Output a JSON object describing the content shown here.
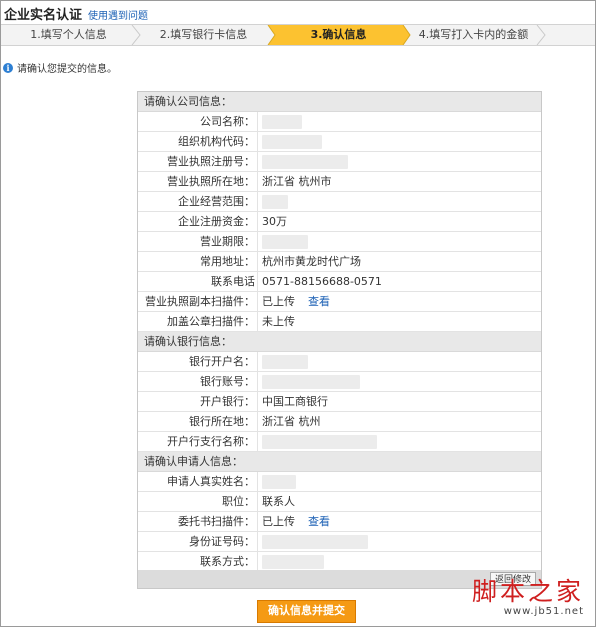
{
  "header": {
    "title": "企业实名认证",
    "help_link": "使用遇到问题"
  },
  "steps": [
    {
      "label": "1.填写个人信息",
      "active": false
    },
    {
      "label": "2.填写银行卡信息",
      "active": false
    },
    {
      "label": "3.确认信息",
      "active": true
    },
    {
      "label": "4.填写打入卡内的金额",
      "active": false
    },
    {
      "label": "",
      "active": false
    }
  ],
  "notice": {
    "text": "请确认您提交的信息。"
  },
  "company": {
    "section_title": "请确认公司信息：",
    "rows": [
      {
        "label": "公司名称：",
        "value": ""
      },
      {
        "label": "组织机构代码：",
        "value": ""
      },
      {
        "label": "营业执照注册号：",
        "value": ""
      },
      {
        "label": "营业执照所在地：",
        "value": "浙江省 杭州市"
      },
      {
        "label": "企业经营范围：",
        "value": ""
      },
      {
        "label": "企业注册资金：",
        "value": "30万"
      },
      {
        "label": "营业期限：",
        "value": ""
      },
      {
        "label": "常用地址：",
        "value": "杭州市黄龙时代广场"
      },
      {
        "label": "联系电话",
        "value": "0571-88156688-0571"
      },
      {
        "label": "营业执照副本扫描件：",
        "value": "已上传",
        "link": "查看"
      },
      {
        "label": "加盖公章扫描件：",
        "value": "未上传"
      }
    ]
  },
  "bank": {
    "section_title": "请确认银行信息：",
    "rows": [
      {
        "label": "银行开户名：",
        "value": ""
      },
      {
        "label": "银行账号：",
        "value": ""
      },
      {
        "label": "开户银行：",
        "value": "中国工商银行"
      },
      {
        "label": "银行所在地：",
        "value": "浙江省 杭州"
      },
      {
        "label": "开户行支行名称：",
        "value": ""
      }
    ]
  },
  "applicant": {
    "section_title": "请确认申请人信息：",
    "rows": [
      {
        "label": "申请人真实姓名：",
        "value": ""
      },
      {
        "label": "职位：",
        "value": "联系人"
      },
      {
        "label": "委托书扫描件：",
        "value": "已上传",
        "link": "查看"
      },
      {
        "label": "身份证号码：",
        "value": ""
      },
      {
        "label": "联系方式：",
        "value": ""
      }
    ]
  },
  "actions": {
    "back_label": "返回修改",
    "submit_label": "确认信息并提交"
  },
  "watermark": {
    "main": "脚本之家",
    "sub": "www.jb51.net"
  },
  "colors": {
    "active_step": "#fcc230",
    "submit": "#f59a14",
    "link": "#1a5fb4",
    "watermark": "#cf1f1f"
  }
}
